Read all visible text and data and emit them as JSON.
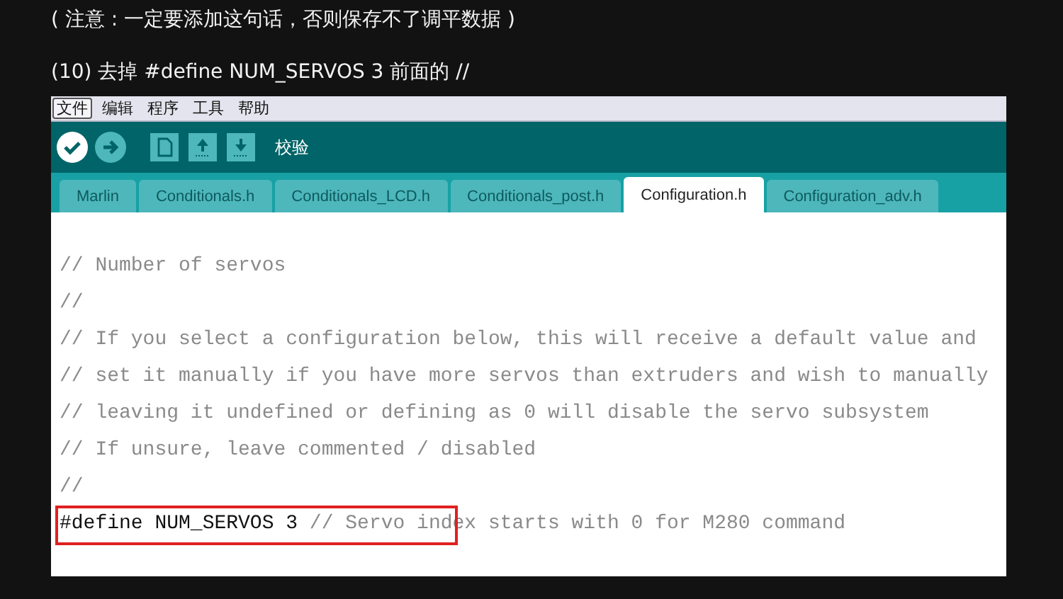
{
  "note": "( 注意 : 一定要添加这句话，否则保存不了调平数据 )",
  "step": "(10) 去掉 #define NUM_SERVOS 3 前面的 //",
  "ide": {
    "menu": [
      {
        "label": "文件",
        "selected": true
      },
      {
        "label": "编辑",
        "selected": false
      },
      {
        "label": "程序",
        "selected": false
      },
      {
        "label": "工具",
        "selected": false
      },
      {
        "label": "帮助",
        "selected": false
      }
    ],
    "toolbar": {
      "buttons": [
        {
          "kind": "verify"
        },
        {
          "kind": "upload"
        },
        {
          "kind": "new"
        },
        {
          "kind": "open"
        },
        {
          "kind": "save"
        }
      ],
      "label": "校验"
    },
    "tabs": [
      {
        "label": "Marlin",
        "selected": false
      },
      {
        "label": "Conditionals.h",
        "selected": false
      },
      {
        "label": "Conditionals_LCD.h",
        "selected": false
      },
      {
        "label": "Conditionals_post.h",
        "selected": false
      },
      {
        "label": "Configuration.h",
        "selected": true
      },
      {
        "label": "Configuration_adv.h",
        "selected": false
      }
    ],
    "code": [
      {
        "kind": "comment",
        "text": "// Number of servos"
      },
      {
        "kind": "comment",
        "text": "//"
      },
      {
        "kind": "comment",
        "text": "// If you select a configuration below, this will receive a default value and"
      },
      {
        "kind": "comment",
        "text": "// set it manually if you have more servos than extruders and wish to manually"
      },
      {
        "kind": "comment",
        "text": "// leaving it undefined or defining as 0 will disable the servo subsystem"
      },
      {
        "kind": "comment",
        "text": "// If unsure, leave commented / disabled"
      },
      {
        "kind": "comment",
        "text": "//"
      },
      {
        "kind": "define",
        "code": "#define NUM_SERVOS 3",
        "comment": "// Servo index starts with 0 for M280 command",
        "highlighted": true
      }
    ]
  }
}
